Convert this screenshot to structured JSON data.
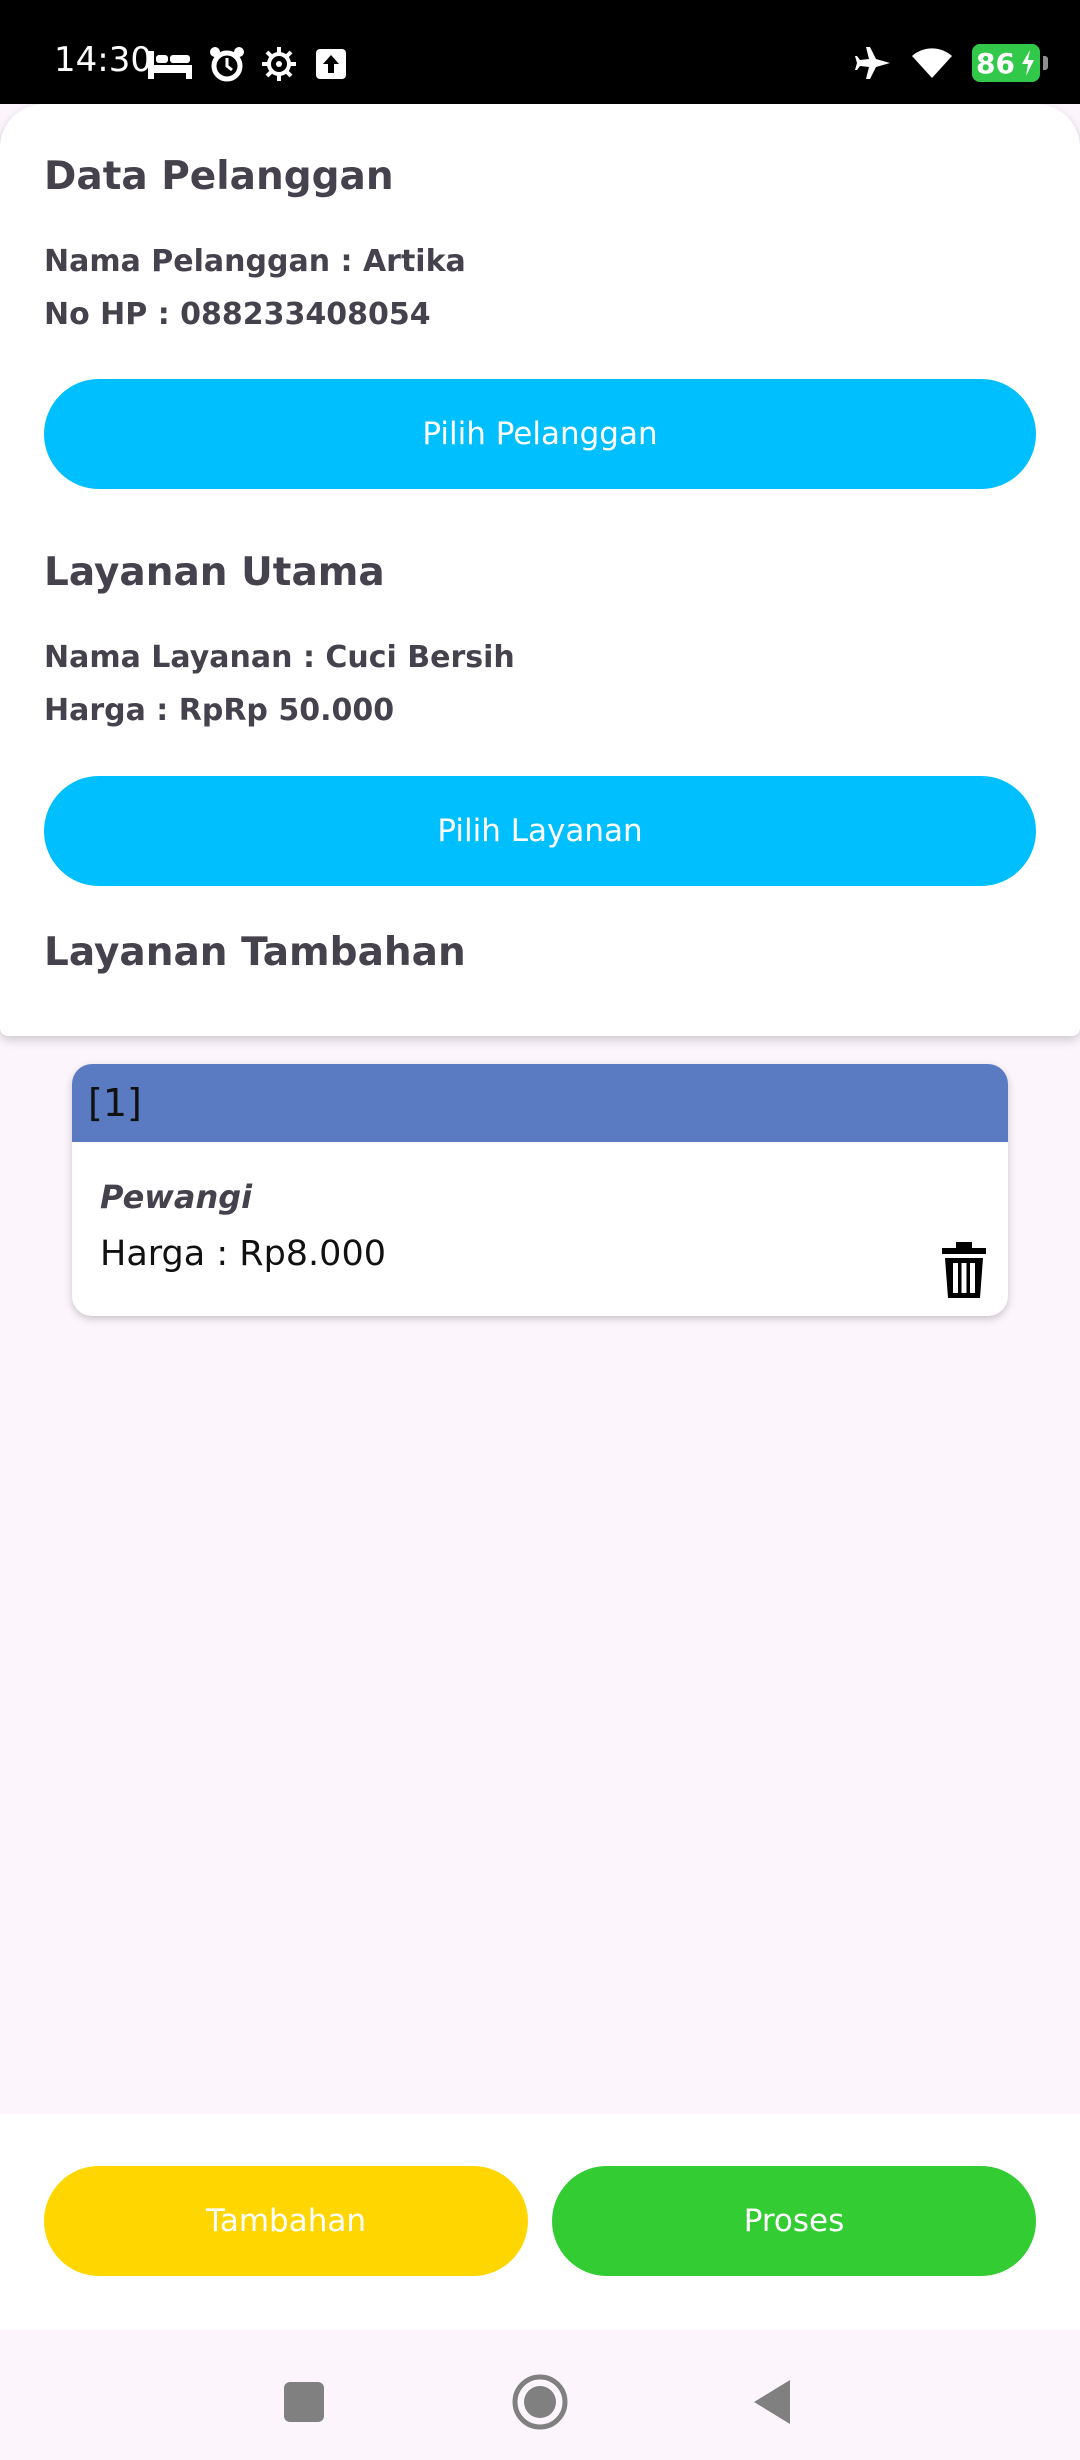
{
  "status_bar": {
    "time": "14:30",
    "battery": "86",
    "left_icons": [
      "bed-icon",
      "alarm-icon",
      "gear-icon",
      "upload-icon"
    ],
    "right_icons": [
      "airplane-icon",
      "wifi-icon",
      "battery-icon"
    ]
  },
  "customer": {
    "heading": "Data Pelanggan",
    "name_line": "Nama Pelanggan : Artika",
    "phone_line": "No HP : 088233408054",
    "select_button": "Pilih Pelanggan"
  },
  "main_service": {
    "heading": "Layanan Utama",
    "name_line": "Nama Layanan : Cuci Bersih",
    "price_line": "Harga : RpRp 50.000",
    "select_button": "Pilih Layanan"
  },
  "extra_services": {
    "heading": "Layanan Tambahan",
    "items": [
      {
        "index": "[1]",
        "name": "Pewangi",
        "price": "Harga : Rp8.000"
      }
    ]
  },
  "actions": {
    "add_label": "Tambahan",
    "process_label": "Proses"
  },
  "colors": {
    "primary_blue": "#00bfff",
    "add_yellow": "#ffd600",
    "process_green": "#33cc33",
    "item_header": "#5a7bc2"
  }
}
